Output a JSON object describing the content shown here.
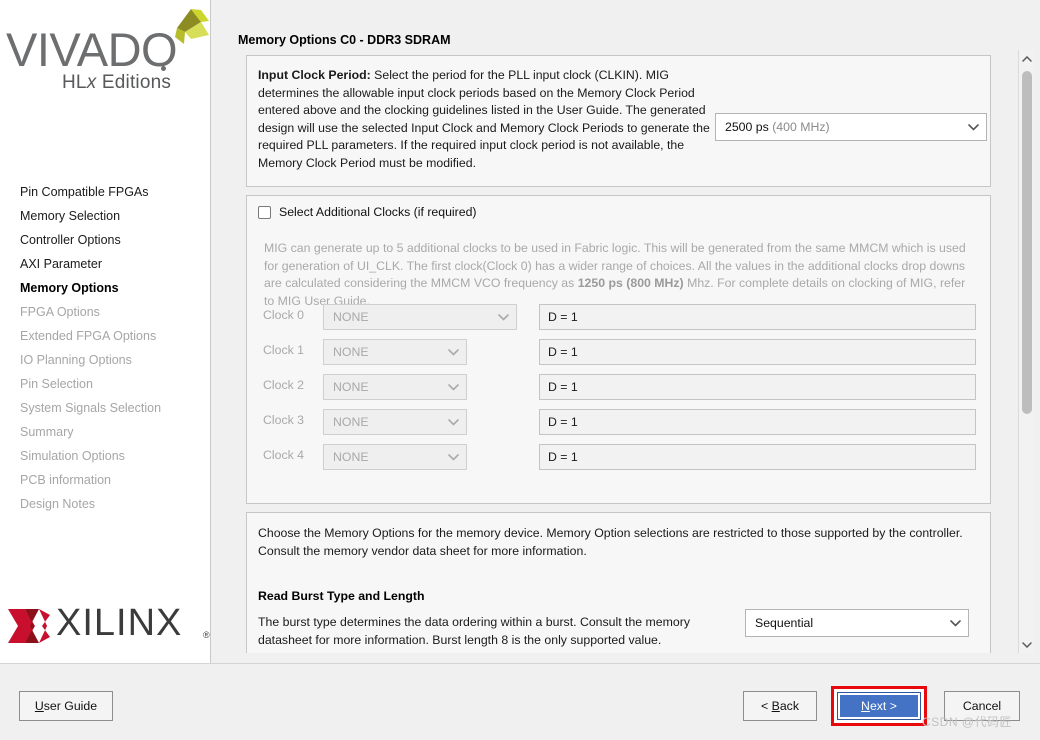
{
  "sidebar": {
    "logo": {
      "word": "VIVADO",
      "edition": "HL",
      "edition_italic": "x",
      "edition_rest": " Editions"
    },
    "items": [
      {
        "label": "Pin Compatible FPGAs",
        "state": "done"
      },
      {
        "label": "Memory Selection",
        "state": "done"
      },
      {
        "label": "Controller Options",
        "state": "done"
      },
      {
        "label": "AXI Parameter",
        "state": "done"
      },
      {
        "label": "Memory Options",
        "state": "active"
      },
      {
        "label": "FPGA Options",
        "state": "muted"
      },
      {
        "label": "Extended FPGA Options",
        "state": "muted"
      },
      {
        "label": "IO Planning Options",
        "state": "muted"
      },
      {
        "label": "Pin Selection",
        "state": "muted"
      },
      {
        "label": "System Signals Selection",
        "state": "muted"
      },
      {
        "label": "Summary",
        "state": "muted"
      },
      {
        "label": "Simulation Options",
        "state": "muted"
      },
      {
        "label": "PCB information",
        "state": "muted"
      },
      {
        "label": "Design Notes",
        "state": "muted"
      }
    ],
    "vendor_logo": {
      "word": "XILINX",
      "registered": "®"
    }
  },
  "main": {
    "page_title": "Memory Options C0 - DDR3 SDRAM",
    "input_clock": {
      "label_bold": "Input Clock Period:",
      "description": " Select the period for the PLL input clock (CLKIN). MIG determines the allowable input clock periods based on the Memory Clock Period entered above and the clocking guidelines listed in the User Guide. The generated design will use the selected Input Clock and Memory Clock Periods to generate the required PLL parameters. If the required input clock period is not available, the Memory Clock Period must be modified.",
      "selected_value": "2500 ps",
      "selected_unit": "(400 MHz)"
    },
    "additional_clocks": {
      "checkbox_label": "Select Additional Clocks (if required)",
      "checked": false,
      "note_part1": "MIG can generate up to 5 additional clocks to be used in Fabric logic. This will be generated from the same MMCM which is used for generation of UI_CLK. The first clock(Clock 0) has a wider range of choices. All the values in the additional clocks drop downs are calculated considering the MMCM VCO frequency as ",
      "note_bold": "1250 ps (800 MHz)",
      "note_part2": " Mhz. For complete details on clocking of MIG, refer to MIG User Guide.",
      "rows": [
        {
          "label": "Clock 0",
          "value": "NONE",
          "divider": "D = 1"
        },
        {
          "label": "Clock 1",
          "value": "NONE",
          "divider": "D = 1"
        },
        {
          "label": "Clock 2",
          "value": "NONE",
          "divider": "D = 1"
        },
        {
          "label": "Clock 3",
          "value": "NONE",
          "divider": "D = 1"
        },
        {
          "label": "Clock 4",
          "value": "NONE",
          "divider": "D = 1"
        }
      ]
    },
    "memory_options": {
      "intro": "Choose the Memory Options for the memory device. Memory Option selections are restricted to those supported by the controller. Consult the memory vendor data sheet for more information.",
      "burst_heading": "Read Burst Type and Length",
      "burst_description": "The burst type determines the data ordering within a burst. Consult the memory datasheet for more information. Burst length 8 is the only supported value.",
      "burst_value": "Sequential"
    }
  },
  "footer": {
    "user_guide": {
      "mnemonic": "U",
      "rest": "ser Guide"
    },
    "back": {
      "prefix": "< ",
      "mnemonic": "B",
      "rest": "ack"
    },
    "next": {
      "mnemonic": "N",
      "rest": "ext",
      "suffix": " >"
    },
    "cancel": "Cancel"
  },
  "watermark": "CSDN @代码匠",
  "colors": {
    "accent_blue": "#4472c4",
    "annotation_red": "#e8090c",
    "xilinx_red": "#c8102e",
    "vivado_gray": "#6d6e70"
  }
}
